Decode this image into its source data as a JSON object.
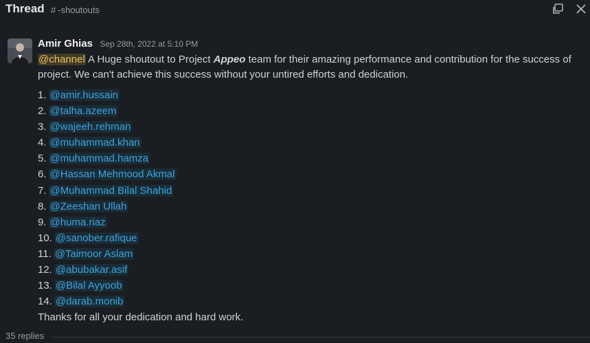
{
  "header": {
    "title": "Thread",
    "channel_hash": "#",
    "channel_name": "-shoutouts"
  },
  "message": {
    "author": "Amir Ghias",
    "timestamp": "Sep 28th, 2022 at 5:10 PM",
    "channel_mention": "@channel",
    "text_part1": " A Huge shoutout to Project ",
    "project_name": "Appeo",
    "text_part2": " team for their amazing performance and contribution for the success of project. We can't achieve this success without your untired efforts and dedication.",
    "mentions": [
      {
        "num": "1.",
        "name": "@amir.hussain"
      },
      {
        "num": "2.",
        "name": "@talha.azeem"
      },
      {
        "num": "3.",
        "name": "@wajeeh.rehman"
      },
      {
        "num": "4.",
        "name": "@muhammad.khan"
      },
      {
        "num": "5.",
        "name": "@muhammad.hamza"
      },
      {
        "num": "6.",
        "name": "@Hassan Mehmood Akmal"
      },
      {
        "num": "7.",
        "name": "@Muhammad Bilal Shahid"
      },
      {
        "num": "8.",
        "name": "@Zeeshan Ullah"
      },
      {
        "num": "9.",
        "name": "@huma.riaz"
      },
      {
        "num": "10.",
        "name": "@sanober.rafique"
      },
      {
        "num": "11.",
        "name": "@Taimoor Aslam"
      },
      {
        "num": "12.",
        "name": "@abubakar.asif"
      },
      {
        "num": "13.",
        "name": "@Bilal Ayyoob"
      },
      {
        "num": "14.",
        "name": "@darab.monib"
      }
    ],
    "closing": "Thanks for all your dedication and hard work."
  },
  "replies": {
    "count_label": "35 replies"
  },
  "icons": {
    "popout": "popout-icon",
    "close": "close-icon"
  },
  "colors": {
    "background": "#1a1d21",
    "mention": "#3aa4e0",
    "channel_mention": "#e8c25a"
  }
}
